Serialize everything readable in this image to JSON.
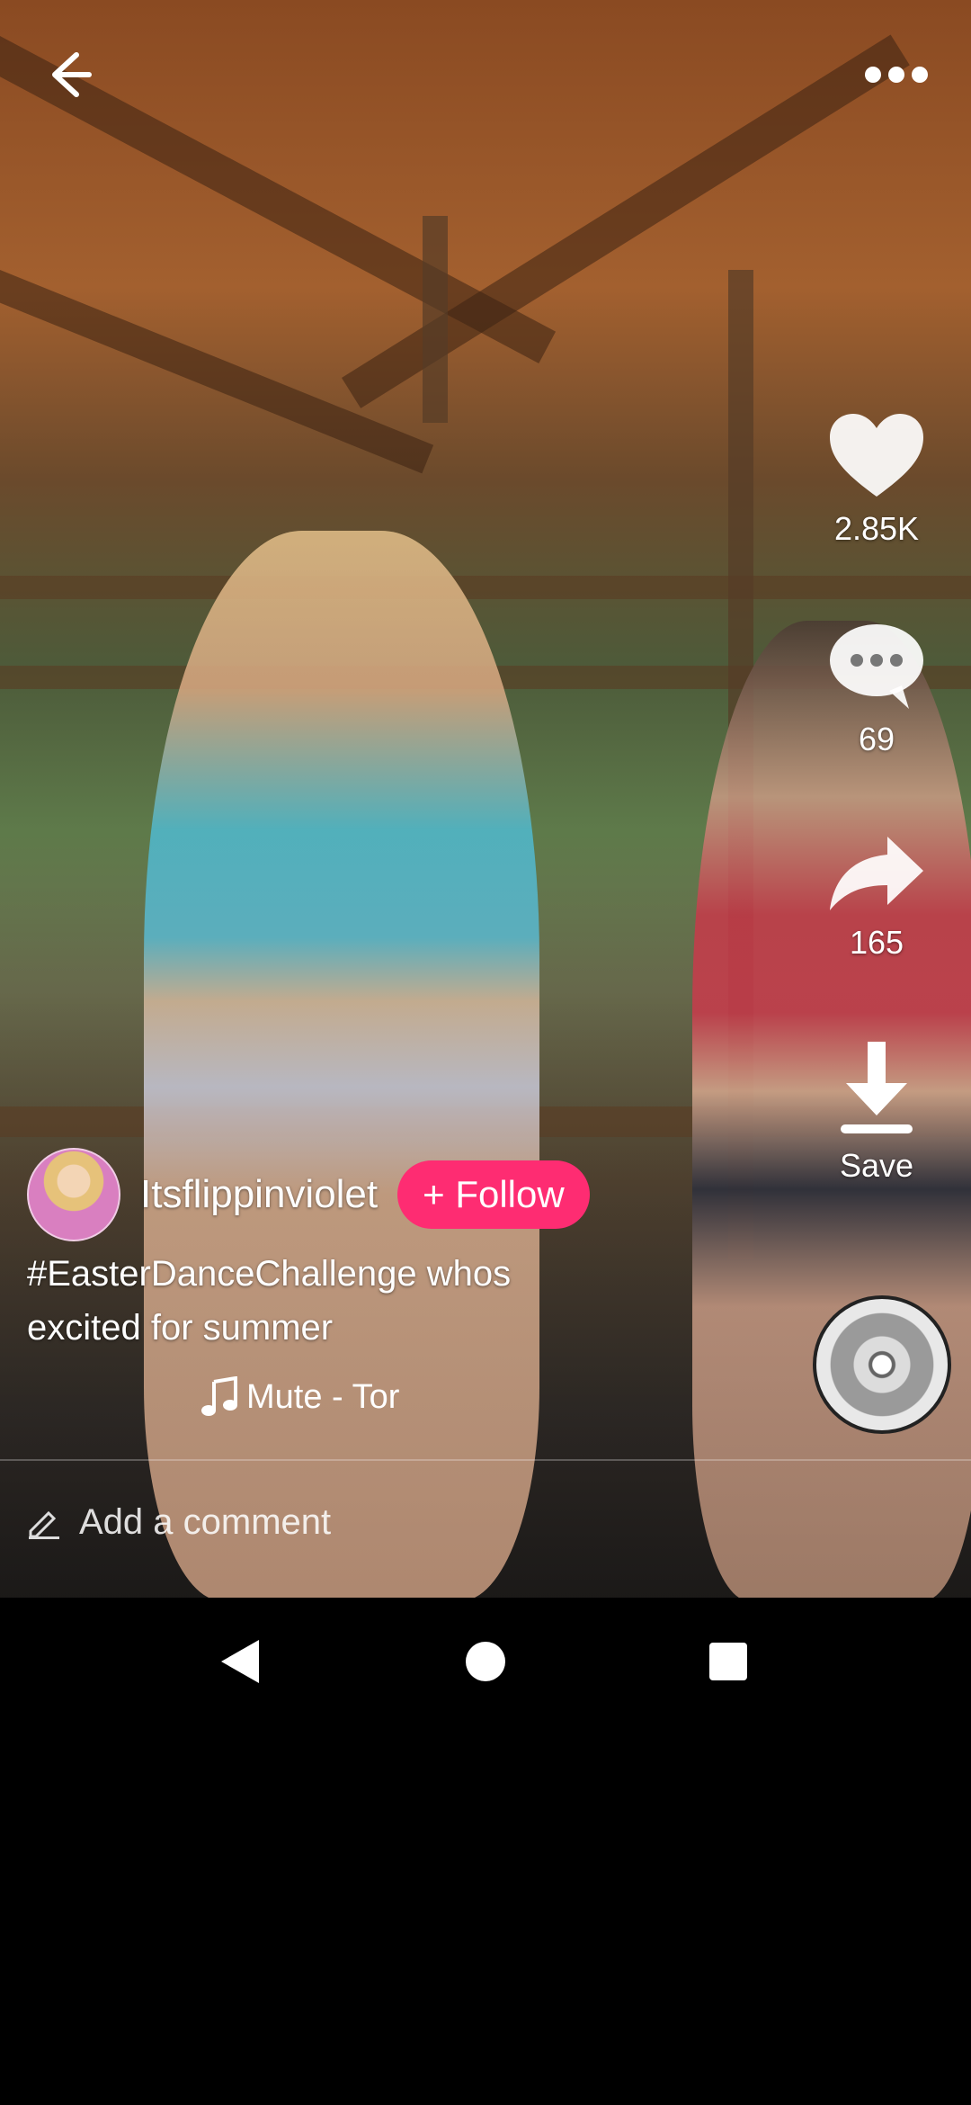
{
  "top_bar": {
    "back_icon": "arrow-left-icon",
    "more_icon": "more-horizontal-icon"
  },
  "actions": {
    "like": {
      "icon": "heart-icon",
      "count": "2.85K"
    },
    "comment": {
      "icon": "comment-bubble-icon",
      "count": "69"
    },
    "share": {
      "icon": "share-arrow-icon",
      "count": "165"
    },
    "save": {
      "icon": "download-icon",
      "label": "Save"
    }
  },
  "author": {
    "username": "Itsflippinviolet",
    "follow_label": "+ Follow"
  },
  "caption": "#EasterDanceChallenge whos excited for summer",
  "music": {
    "icon": "music-note-icon",
    "title": "Mute - Tor"
  },
  "comment_input": {
    "icon": "pencil-icon",
    "placeholder": "Add a comment"
  },
  "colors": {
    "follow": "#fe2c72"
  }
}
